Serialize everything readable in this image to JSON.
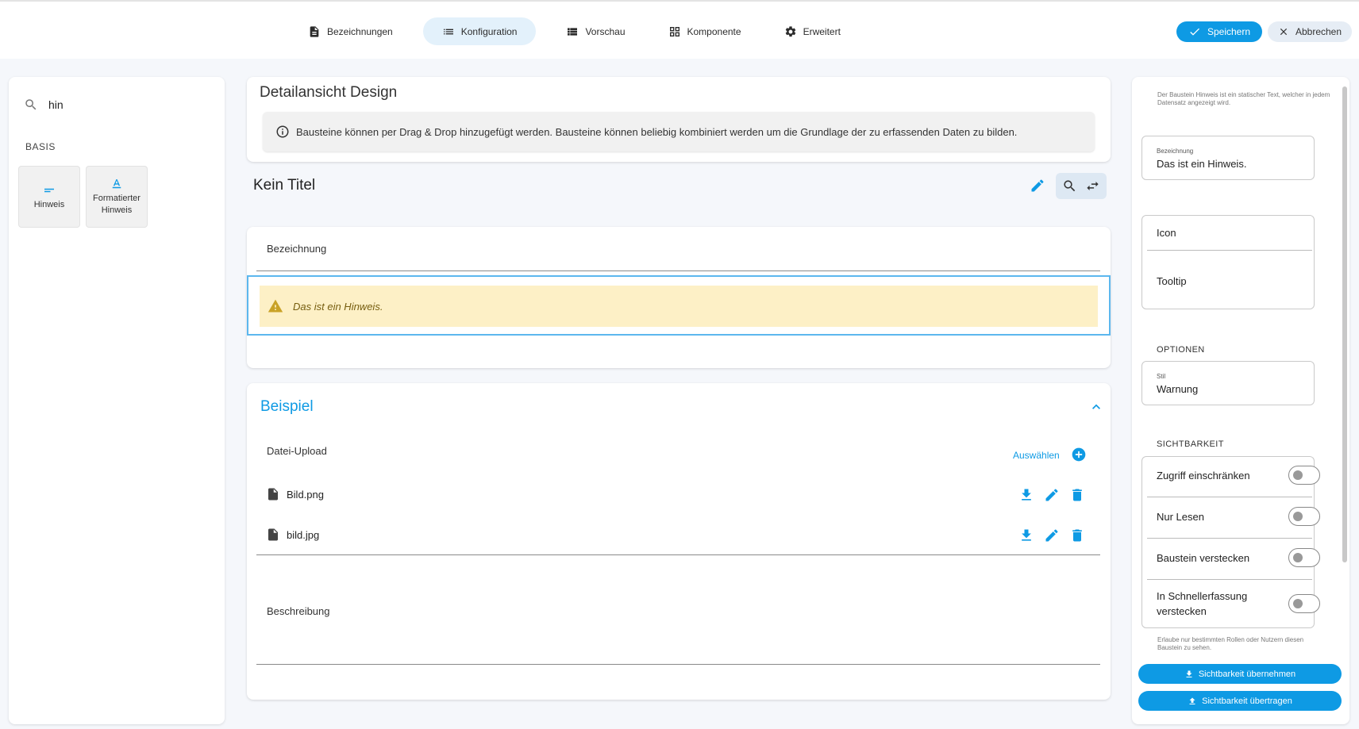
{
  "tabs": [
    {
      "label": "Bezeichnungen",
      "icon": "document-icon"
    },
    {
      "label": "Konfiguration",
      "icon": "list-icon"
    },
    {
      "label": "Vorschau",
      "icon": "table-icon"
    },
    {
      "label": "Komponente",
      "icon": "grid-icon"
    },
    {
      "label": "Erweitert",
      "icon": "gear-icon"
    }
  ],
  "header": {
    "save_label": "Speichern",
    "cancel_label": "Abbrechen"
  },
  "palette": {
    "search_value": "hin",
    "section": "BASIS",
    "items": [
      {
        "label": "Hinweis",
        "icon": "short-text-icon"
      },
      {
        "label": "Formatierter Hinweis",
        "icon": "text-format-icon"
      }
    ]
  },
  "design": {
    "title": "Detailansicht Design",
    "info": "Bausteine können per Drag & Drop hinzugefügt werden. Bausteine können beliebig kombiniert werden um die Grundlage der zu erfassenden Daten zu bilden."
  },
  "form": {
    "title": "Kein Titel",
    "field_label": "Bezeichnung",
    "warning_text": "Das ist ein Hinweis."
  },
  "example": {
    "title": "Beispiel",
    "upload_label": "Datei-Upload",
    "select_link": "Auswählen",
    "files": [
      "Bild.png",
      "bild.jpg"
    ],
    "description_label": "Beschreibung"
  },
  "properties": {
    "hint": "Der Baustein Hinweis ist ein statischer Text, welcher in jedem Datensatz angezeigt wird.",
    "name_label": "Bezeichnung",
    "name_value": "Das ist ein Hinweis.",
    "icon_label": "Icon",
    "tooltip_label": "Tooltip",
    "options_heading": "OPTIONEN",
    "style_label": "Stil",
    "style_value": "Warnung",
    "visibility_heading": "SICHTBARKEIT",
    "toggles": [
      {
        "label": "Zugriff einschränken"
      },
      {
        "label": "Nur Lesen"
      },
      {
        "label": "Baustein verstecken"
      },
      {
        "label": "In Schnellerfassung verstecken"
      }
    ],
    "visibility_hint": "Erlaube nur bestimmten Rollen oder Nutzern diesen Baustein zu sehen.",
    "apply_label": "Sichtbarkeit übernehmen",
    "transfer_label": "Sichtbarkeit übertragen"
  },
  "colors": {
    "accent": "#0e9ae4",
    "warning_bg": "#fdf0c6",
    "selection": "#5cb7ee"
  }
}
